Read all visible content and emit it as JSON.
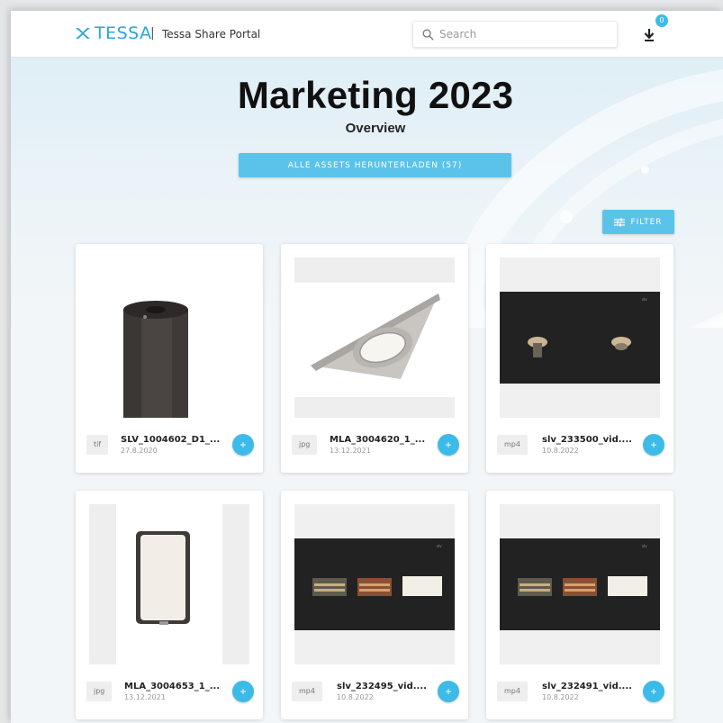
{
  "header": {
    "logo_text": "TESSA",
    "separator": "|",
    "portal_title": "Tessa Share Portal",
    "search_placeholder": "Search",
    "download_count": "0"
  },
  "page": {
    "title": "Marketing 2023",
    "subtitle": "Overview",
    "download_all_label": "ALLE ASSETS HERUNTERLADEN (57)",
    "filter_label": "FILTER"
  },
  "assets": [
    {
      "ext": "tif",
      "name": "SLV_1004602_D1_...",
      "date": "27.8.2020"
    },
    {
      "ext": "jpg",
      "name": "MLA_3004620_1_...",
      "date": "13.12.2021"
    },
    {
      "ext": "mp4",
      "name": "slv_233500_vid....",
      "date": "10.8.2022"
    },
    {
      "ext": "jpg",
      "name": "MLA_3004653_1_...",
      "date": "13.12.2021"
    },
    {
      "ext": "mp4",
      "name": "slv_232495_vid....",
      "date": "10.8.2022"
    },
    {
      "ext": "mp4",
      "name": "slv_232491_vid....",
      "date": "10.8.2022"
    }
  ],
  "add_label": "+",
  "colors": {
    "accent": "#3dbbe8",
    "brand": "#2aa6dc",
    "background": "#f3f6f8"
  }
}
